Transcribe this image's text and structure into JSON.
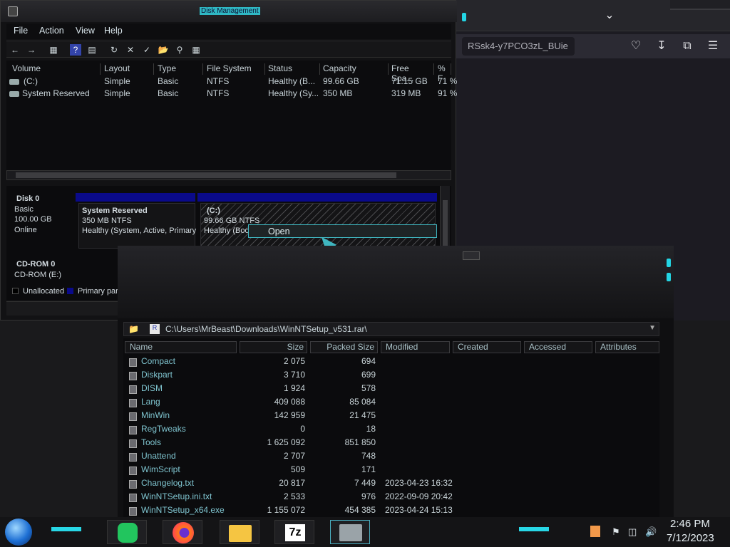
{
  "browser": {
    "url_fragment": "RSsk4-y7PCO3zL_BUie",
    "icons": [
      "chevron-down-icon",
      "pocket-icon",
      "download-icon",
      "extensions-icon",
      "menu-icon"
    ]
  },
  "disk_management": {
    "title": "Disk Management",
    "menu": [
      "File",
      "Action",
      "View",
      "Help"
    ],
    "volume_headers": [
      "Volume",
      "Layout",
      "Type",
      "File System",
      "Status",
      "Capacity",
      "Free Spa...",
      "% F"
    ],
    "volumes": [
      {
        "volume": "(C:)",
        "layout": "Simple",
        "type": "Basic",
        "fs": "NTFS",
        "status": "Healthy (B...",
        "capacity": "99.66 GB",
        "free": "71.15 GB",
        "pct": "71 %"
      },
      {
        "volume": "System Reserved",
        "layout": "Simple",
        "type": "Basic",
        "fs": "NTFS",
        "status": "Healthy (Sy...",
        "capacity": "350 MB",
        "free": "319 MB",
        "pct": "91 %"
      }
    ],
    "disk0": {
      "name": "Disk 0",
      "kind": "Basic",
      "size": "100.00 GB",
      "state": "Online"
    },
    "sysres": {
      "name": "System Reserved",
      "size": "350 MB NTFS",
      "status": "Healthy (System, Active, Primary"
    },
    "cpart": {
      "name": "(C:)",
      "size": "99.66 GB NTFS",
      "status": "Healthy (Boot"
    },
    "cdrom": {
      "name": "CD-ROM 0",
      "drive": "CD-ROM (E:)"
    },
    "legend": {
      "unallocated": "Unallocated",
      "primary": "Primary partition"
    },
    "colors": {
      "primary": "#0a0a8a",
      "accent": "#2fb8c4"
    }
  },
  "context_menu": {
    "open": "Open"
  },
  "rar": {
    "path": "C:\\Users\\MrBeast\\Downloads\\WinNTSetup_v531.rar\\",
    "headers": [
      "Name",
      "Size",
      "Packed Size",
      "Modified",
      "Created",
      "Accessed",
      "Attributes"
    ],
    "files": [
      {
        "name": "Compact",
        "size": "2 075",
        "packed": "694",
        "modified": ""
      },
      {
        "name": "Diskpart",
        "size": "3 710",
        "packed": "699",
        "modified": ""
      },
      {
        "name": "DISM",
        "size": "1 924",
        "packed": "578",
        "modified": ""
      },
      {
        "name": "Lang",
        "size": "409 088",
        "packed": "85 084",
        "modified": ""
      },
      {
        "name": "MinWin",
        "size": "142 959",
        "packed": "21 475",
        "modified": ""
      },
      {
        "name": "RegTweaks",
        "size": "0",
        "packed": "18",
        "modified": ""
      },
      {
        "name": "Tools",
        "size": "1 625 092",
        "packed": "851 850",
        "modified": ""
      },
      {
        "name": "Unattend",
        "size": "2 707",
        "packed": "748",
        "modified": ""
      },
      {
        "name": "WimScript",
        "size": "509",
        "packed": "171",
        "modified": ""
      },
      {
        "name": "Changelog.txt",
        "size": "20 817",
        "packed": "7 449",
        "modified": "2023-04-23 16:32"
      },
      {
        "name": "WinNTSetup.ini.txt",
        "size": "2 533",
        "packed": "976",
        "modified": "2022-09-09 20:42"
      },
      {
        "name": "WinNTSetup_x64.exe",
        "size": "1 155 072",
        "packed": "454 385",
        "modified": "2023-04-24 15:13"
      }
    ]
  },
  "taskbar": {
    "time": "2:46 PM",
    "date": "7/12/2023",
    "seven_zip": "7z"
  }
}
